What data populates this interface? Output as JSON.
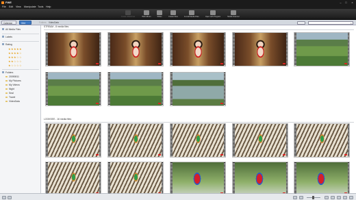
{
  "window": {
    "title": "FWE"
  },
  "menu": [
    "File",
    "Edit",
    "View",
    "Manipulate",
    "Tools",
    "Help"
  ],
  "toolbar": {
    "buttons": [
      {
        "label": "Create Slideshow"
      },
      {
        "label": "Web Album"
      },
      {
        "label": "Slides"
      },
      {
        "label": "Create Files"
      },
      {
        "label": "E-mail Media Files"
      },
      {
        "label": "Open with Program"
      },
      {
        "label": "Media Scanner"
      }
    ]
  },
  "subbar": {
    "view_buttons": [
      "Calendar",
      "Grid"
    ],
    "breadcrumb": [
      "Folders",
      "VideoData"
    ],
    "search_placeholder": ""
  },
  "sidebar": {
    "all_media": "All Media Files",
    "labels": "Labels",
    "rating": "Rating",
    "star_rows": [
      "★★★★★",
      "★★★★☆",
      "★★★☆☆",
      "★★☆☆☆",
      "★☆☆☆☆"
    ],
    "folders_header": "Folders",
    "folders": [
      "20090811",
      "My Pictures",
      "My Videos",
      "Night",
      "Seal",
      "Travel",
      "VideoData"
    ]
  },
  "groups": [
    {
      "title": "STREAM  -  8 media files",
      "items": [
        "bride",
        "bride",
        "bride",
        "bride",
        "field",
        "field",
        "field",
        "pond"
      ]
    },
    {
      "title": "LOOKSEE  -  16 media files",
      "items": [
        "cockatoo",
        "cockatoo",
        "cockatoo",
        "cockatoo",
        "cockatoo",
        "cockatoo",
        "cockatoo",
        "macaw",
        "macaw",
        "macaw"
      ]
    }
  ]
}
